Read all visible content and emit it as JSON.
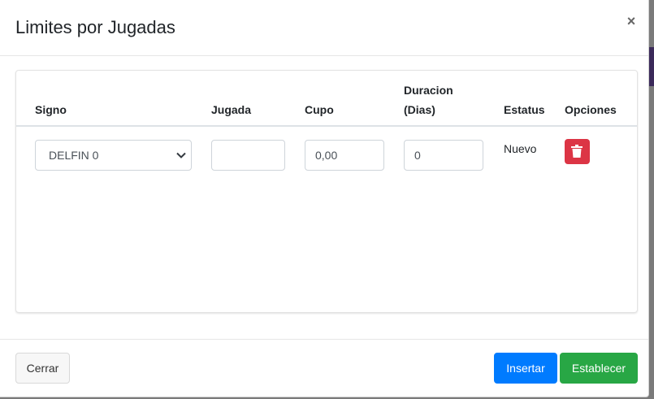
{
  "modal": {
    "title": "Limites por Jugadas",
    "close_symbol": "×"
  },
  "table": {
    "headers": {
      "signo": "Signo",
      "jugada": "Jugada",
      "cupo": "Cupo",
      "duracion_line1": "Duracion",
      "duracion_line2": "(Dias)",
      "estatus": "Estatus",
      "opciones": "Opciones"
    },
    "rows": [
      {
        "signo": "DELFIN 0",
        "jugada": "",
        "cupo": "0,00",
        "duracion": "0",
        "estatus": "Nuevo",
        "delete_icon": "trash-icon"
      }
    ]
  },
  "footer": {
    "close_label": "Cerrar",
    "insert_label": "Insertar",
    "set_label": "Establecer"
  },
  "colors": {
    "primary": "#007bff",
    "success": "#28a745",
    "danger": "#dc3545"
  }
}
